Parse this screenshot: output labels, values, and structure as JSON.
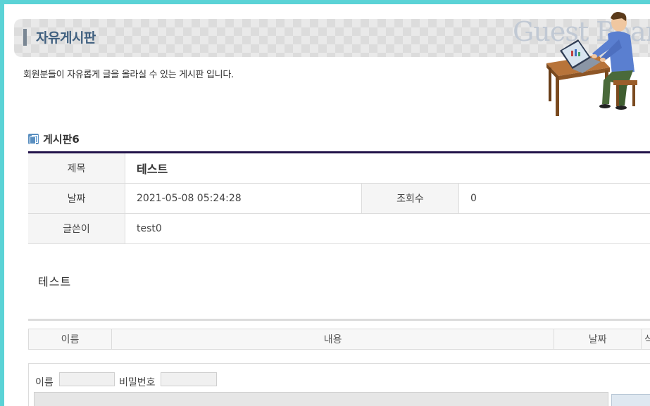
{
  "header": {
    "title": "자유게시판",
    "watermark": "Guest Board",
    "description": "회원분들이 자유롭게 글을 올라실 수 있는 게시판 입니다."
  },
  "board": {
    "name": "게시판6"
  },
  "post": {
    "subject_label": "제목",
    "subject": "테스트",
    "date_label": "날짜",
    "date": "2021-05-08 05:24:28",
    "views_label": "조회수",
    "views": "0",
    "author_label": "글쓴이",
    "author": "test0",
    "content": "테스트"
  },
  "comments": {
    "columns": [
      "이름",
      "내용",
      "날짜",
      "삭"
    ]
  },
  "comment_form": {
    "name_label": "이름",
    "name_value": "",
    "password_label": "비밀번호",
    "password_value": ""
  }
}
